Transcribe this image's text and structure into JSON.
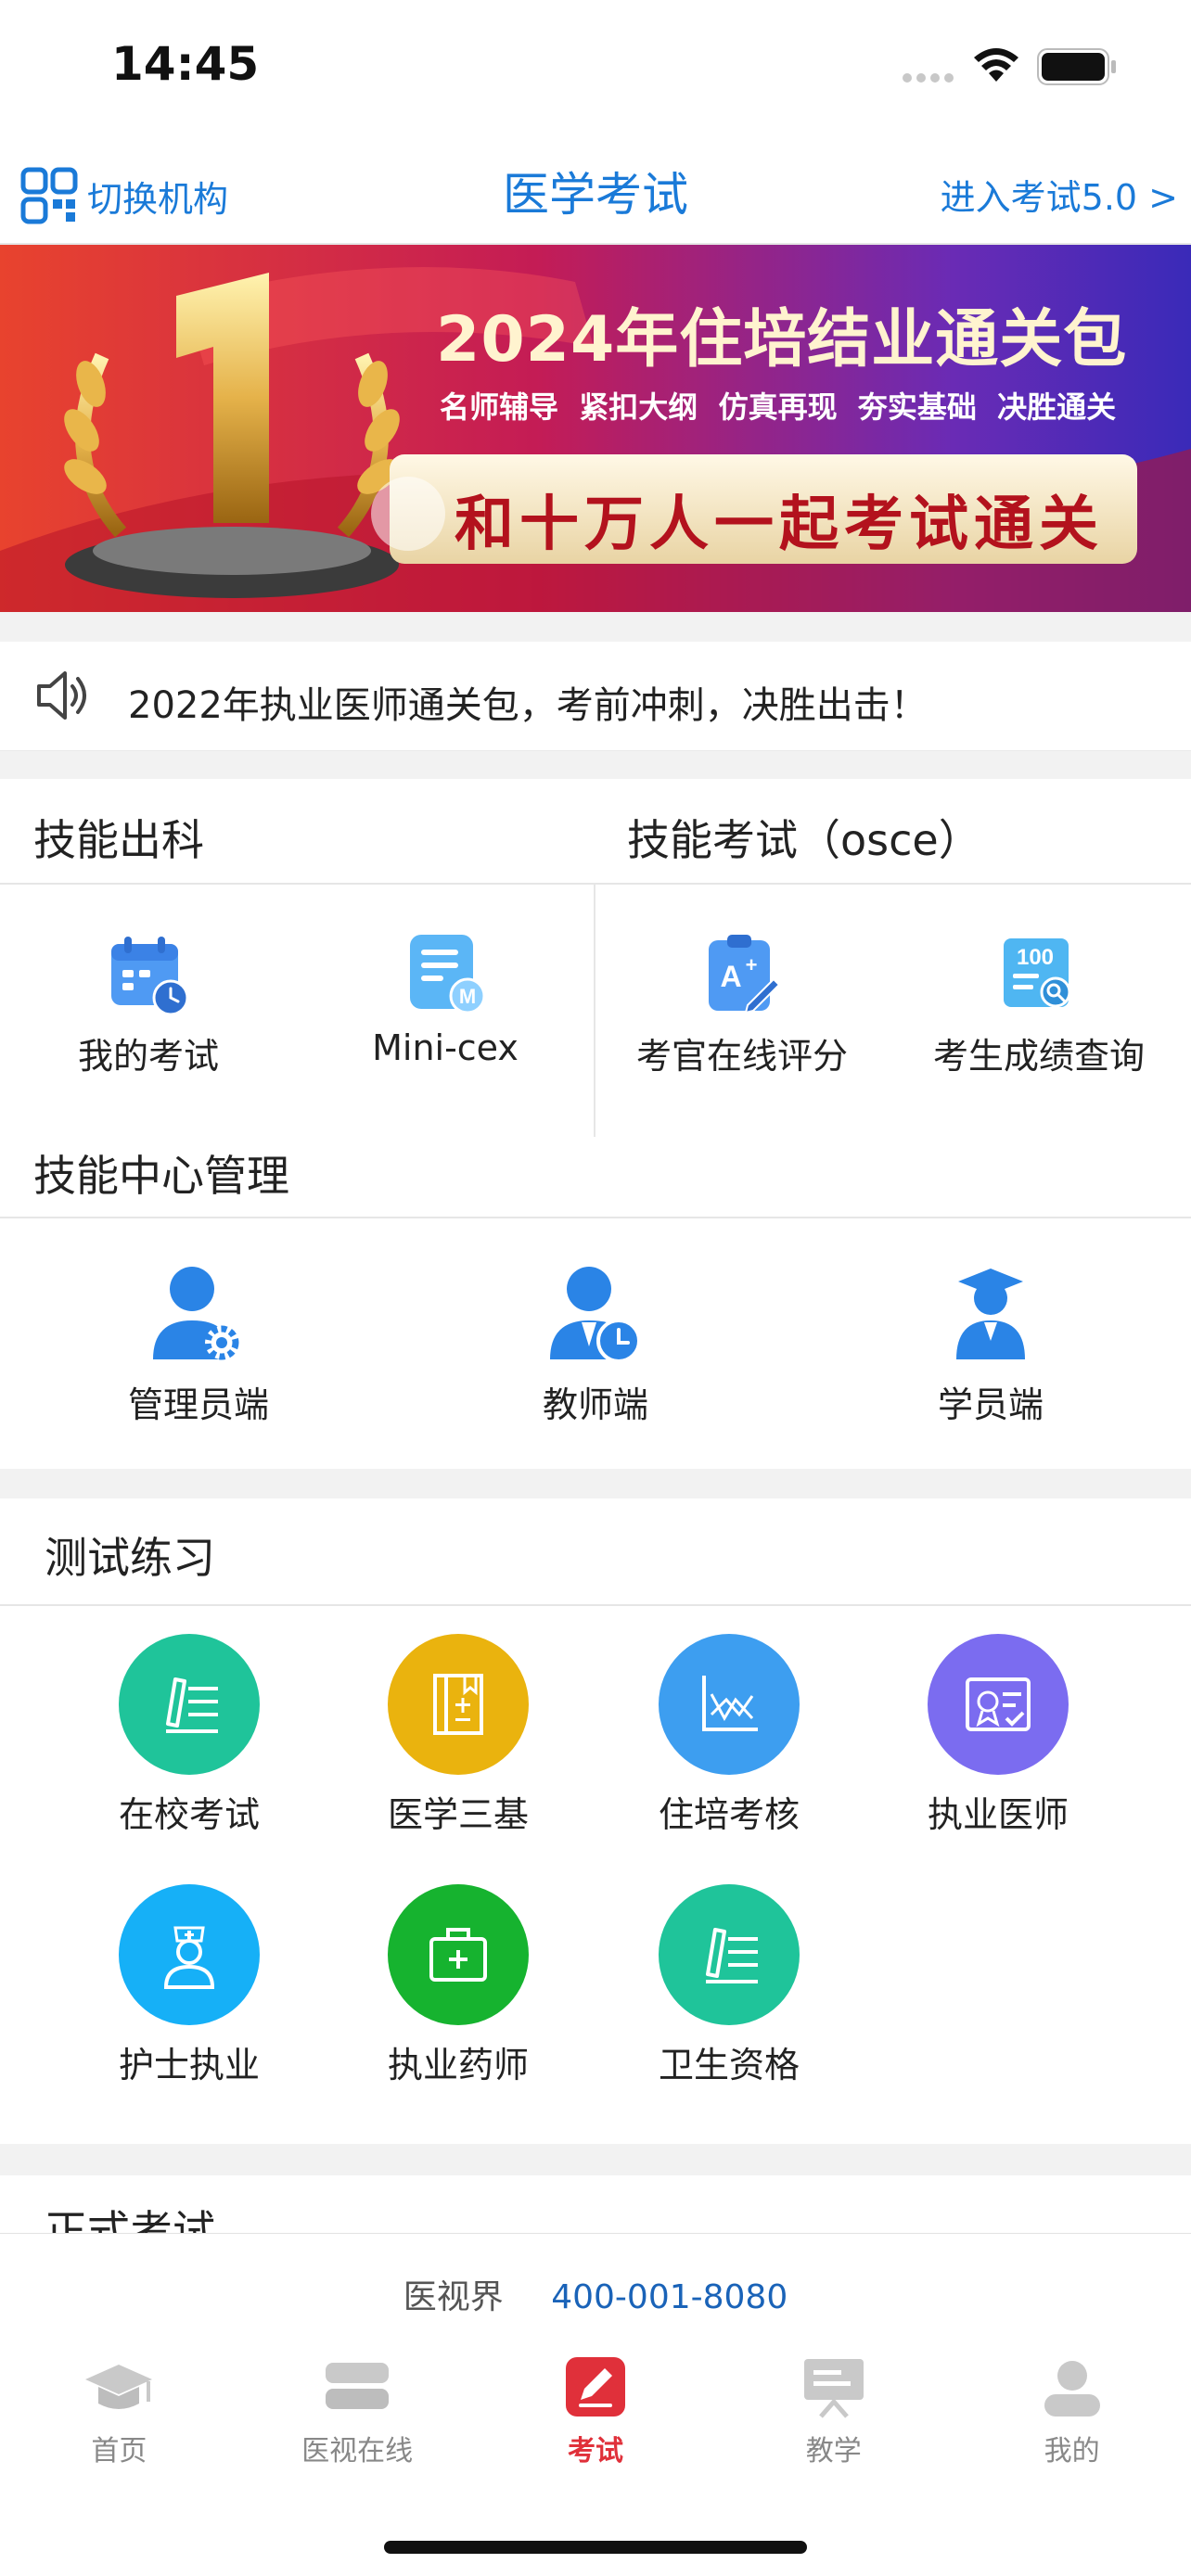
{
  "status_bar": {
    "time": "14:45"
  },
  "header": {
    "switch_label": "切换机构",
    "title": "医学考试",
    "enter_label": "进入考试5.0 >"
  },
  "banner": {
    "headline": "2024年住培结业通关包",
    "tags": "名师辅导  紧扣大纲  仿真再现  夯实基础  决胜通关",
    "slogan": "和十万人一起考试通关",
    "rank": "1"
  },
  "notice": {
    "text": "2022年执业医师通关包，考前冲刺，决胜出击！"
  },
  "skills": {
    "left_title": "技能出科",
    "right_title": "技能考试（osce）",
    "items": [
      {
        "label": "我的考试",
        "icon": "calendar-clock-icon"
      },
      {
        "label": "Mini-cex",
        "icon": "document-m-icon"
      },
      {
        "label": "考官在线评分",
        "icon": "clipboard-grade-icon"
      },
      {
        "label": "考生成绩查询",
        "icon": "score-search-icon"
      }
    ]
  },
  "center": {
    "title": "技能中心管理",
    "items": [
      {
        "label": "管理员端",
        "icon": "admin-user-icon"
      },
      {
        "label": "教师端",
        "icon": "teacher-user-icon"
      },
      {
        "label": "学员端",
        "icon": "student-user-icon"
      }
    ]
  },
  "practice": {
    "title": "测试练习",
    "items": [
      {
        "label": "在校考试",
        "icon": "pen-list-icon",
        "color": "#1fc49a"
      },
      {
        "label": "医学三基",
        "icon": "book-icon",
        "color": "#eab30e"
      },
      {
        "label": "住培考核",
        "icon": "chart-icon",
        "color": "#3d9ef0"
      },
      {
        "label": "执业医师",
        "icon": "certificate-icon",
        "color": "#7b6cf0"
      },
      {
        "label": "护士执业",
        "icon": "nurse-icon",
        "color": "#16b0f7"
      },
      {
        "label": "执业药师",
        "icon": "medkit-icon",
        "color": "#16b32f"
      },
      {
        "label": "卫生资格",
        "icon": "pen-list-icon",
        "color": "#1fc49a"
      }
    ]
  },
  "formal": {
    "title": "正式考试"
  },
  "footer": {
    "brand": "医视界",
    "phone": "400-001-8080"
  },
  "tabs": [
    {
      "label": "首页",
      "icon": "graduation-cap-icon",
      "active": false
    },
    {
      "label": "医视在线",
      "icon": "stack-icon",
      "active": false
    },
    {
      "label": "考试",
      "icon": "edit-icon",
      "active": true
    },
    {
      "label": "教学",
      "icon": "presentation-icon",
      "active": false
    },
    {
      "label": "我的",
      "icon": "profile-icon",
      "active": false
    }
  ],
  "colors": {
    "accent": "#1a7ad8",
    "active_tab": "#e0303a"
  }
}
